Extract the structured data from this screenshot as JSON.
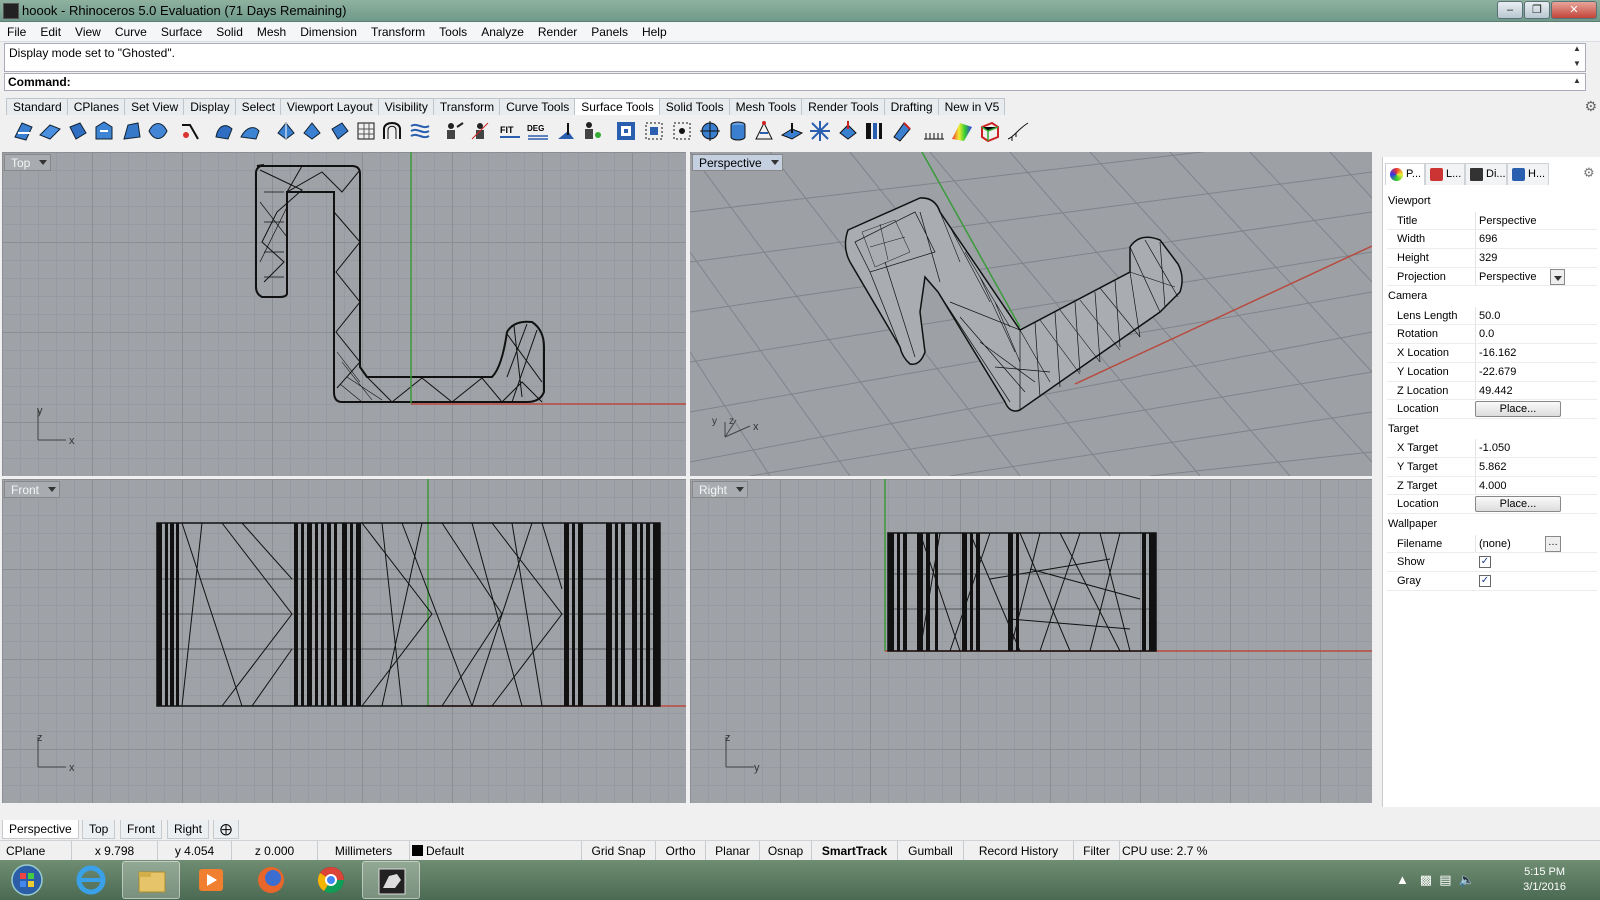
{
  "window": {
    "title": "hoook - Rhinoceros 5.0 Evaluation (71 Days Remaining)"
  },
  "menu": [
    "File",
    "Edit",
    "View",
    "Curve",
    "Surface",
    "Solid",
    "Mesh",
    "Dimension",
    "Transform",
    "Tools",
    "Analyze",
    "Render",
    "Panels",
    "Help"
  ],
  "command": {
    "history": "Display mode set to \"Ghosted\".",
    "prompt": "Command:"
  },
  "toolbar_tabs": [
    "Standard",
    "CPlanes",
    "Set View",
    "Display",
    "Select",
    "Viewport Layout",
    "Visibility",
    "Transform",
    "Curve Tools",
    "Surface Tools",
    "Solid Tools",
    "Mesh Tools",
    "Render Tools",
    "Drafting",
    "New in V5"
  ],
  "toolbar_active_tab": "Surface Tools",
  "toolbar_icon_text": {
    "fit": "FIT",
    "deg": "DEG"
  },
  "viewports": {
    "top": {
      "label": "Top",
      "axis_h": "x",
      "axis_v": "y"
    },
    "perspective": {
      "label": "Perspective",
      "axis_h": "x",
      "axis_v": "z",
      "axis_y": "y"
    },
    "front": {
      "label": "Front",
      "axis_h": "x",
      "axis_v": "z"
    },
    "right": {
      "label": "Right",
      "axis_h": "y",
      "axis_v": "z"
    }
  },
  "panel": {
    "tabs": [
      "P...",
      "L...",
      "Di...",
      "H..."
    ],
    "sections": {
      "viewport": "Viewport",
      "camera": "Camera",
      "target": "Target",
      "wallpaper": "Wallpaper"
    },
    "viewport": [
      {
        "label": "Title",
        "value": "Perspective"
      },
      {
        "label": "Width",
        "value": "696"
      },
      {
        "label": "Height",
        "value": "329"
      },
      {
        "label": "Projection",
        "value": "Perspective"
      }
    ],
    "camera": [
      {
        "label": "Lens Length",
        "value": "50.0"
      },
      {
        "label": "Rotation",
        "value": "0.0"
      },
      {
        "label": "X Location",
        "value": "-16.162"
      },
      {
        "label": "Y Location",
        "value": "-22.679"
      },
      {
        "label": "Z Location",
        "value": "49.442"
      },
      {
        "label": "Location",
        "button": "Place..."
      }
    ],
    "target": [
      {
        "label": "X Target",
        "value": "-1.050"
      },
      {
        "label": "Y Target",
        "value": "5.862"
      },
      {
        "label": "Z Target",
        "value": "4.000"
      },
      {
        "label": "Location",
        "button": "Place..."
      }
    ],
    "wallpaper": [
      {
        "label": "Filename",
        "value": "(none)"
      },
      {
        "label": "Show",
        "checked": true
      },
      {
        "label": "Gray",
        "checked": true
      }
    ]
  },
  "viewport_tabs": [
    "Perspective",
    "Top",
    "Front",
    "Right"
  ],
  "viewport_tabs_active": "Perspective",
  "status": {
    "cplane": "CPlane",
    "x": "x 9.798",
    "y": "y 4.054",
    "z": "z 0.000",
    "units": "Millimeters",
    "layer": "Default",
    "grid_snap": "Grid Snap",
    "ortho": "Ortho",
    "planar": "Planar",
    "osnap": "Osnap",
    "smarttrack": "SmartTrack",
    "gumball": "Gumball",
    "record_history": "Record History",
    "filter": "Filter",
    "cpu": "CPU use: 2.7 %"
  },
  "taskbar": {
    "time": "5:15 PM",
    "date": "3/1/2016"
  },
  "colors": {
    "x_axis": "#b84a3f",
    "y_axis": "#3b9a3b",
    "viewport_bg": "#9fa2a7",
    "titlebar": "#7fa594"
  }
}
